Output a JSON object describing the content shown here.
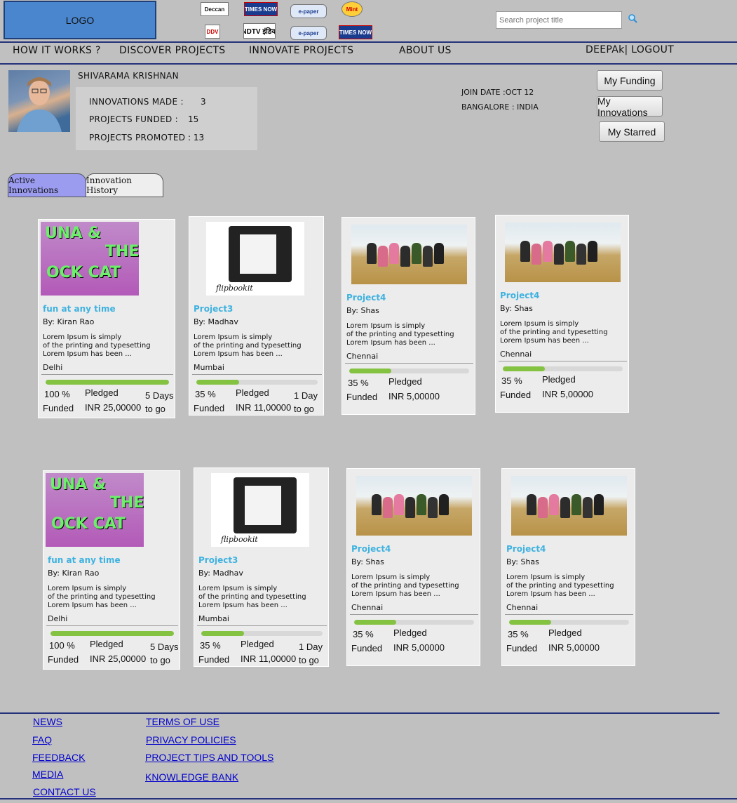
{
  "header": {
    "logo": "LOGO",
    "search": {
      "placeholder": "Search project title",
      "value": "Search project title"
    },
    "media_logos": [
      "Deccan",
      "TIMES NOW",
      "e-paper",
      "Mint",
      "DDV",
      "NDTV इंडिया",
      "e-paper",
      "TIMES NOW"
    ]
  },
  "nav": {
    "how_it_works": "HOW IT WORKS ?",
    "discover": "DISCOVER PROJECTS",
    "innovate": "INNOVATE PROJECTS",
    "about": "ABOUT US",
    "user": "DEEPAk| LOGOUT"
  },
  "profile": {
    "name": "SHIVARAMA KRISHNAN",
    "innovations_label": "INNOVATIONS MADE :",
    "innovations_value": "3",
    "funded_label": "PROJECTS FUNDED :",
    "funded_value": "15",
    "promoted_label": "PROJECTS PROMOTED",
    "promoted_value": ": 13",
    "join_date": "JOIN DATE :OCT 12",
    "location": "BANGALORE : INDIA"
  },
  "buttons": {
    "funding": "My Funding",
    "innovations": "My Innovations",
    "starred": "My Starred"
  },
  "tabs": {
    "active": "Active Innovations",
    "history": "Innovation History"
  },
  "colors": {
    "accent": "#3fb2e0",
    "progress": "#84c242",
    "tab_active": "#9b9bf0",
    "rule": "#26327a"
  },
  "cards": [
    {
      "title": "fun at any time",
      "by": "By:  Kiran Rao",
      "desc1": "Lorem Ipsum is simply",
      "desc2": "of the printing and typesetting",
      "desc3": "Lorem Ipsum has been ...",
      "location": "Delhi",
      "progress": 1.0,
      "funded": "100 %",
      "funded_label": "Funded",
      "pledged_label": "Pledged",
      "pledged": "INR 25,00000",
      "days": "5 Days",
      "days_label": "to go"
    },
    {
      "title": "Project3",
      "by": "By:  Madhav",
      "desc1": "Lorem Ipsum is simply",
      "desc2": "of the printing and typesetting",
      "desc3": "Lorem Ipsum has been ...",
      "location": "Mumbai",
      "progress": 0.35,
      "funded": "35 %",
      "funded_label": "Funded",
      "pledged_label": "Pledged",
      "pledged": "INR 11,00000",
      "days": "1 Day",
      "days_label": "to go"
    },
    {
      "title": "Project4",
      "by": "By:  Shas",
      "desc1": "Lorem Ipsum is simply",
      "desc2": "of the printing and typesetting",
      "desc3": "Lorem Ipsum has been ...",
      "location": "Chennai",
      "progress": 0.35,
      "funded": "35 %",
      "funded_label": "Funded",
      "pledged_label": "Pledged",
      "pledged": "INR 5,00000"
    },
    {
      "title": "Project4",
      "by": "By:  Shas",
      "desc1": "Lorem Ipsum is simply",
      "desc2": "of the printing and typesetting",
      "desc3": "Lorem Ipsum has been ...",
      "location": "Chennai",
      "progress": 0.35,
      "funded": "35 %",
      "funded_label": "Funded",
      "pledged_label": "Pledged",
      "pledged": "INR 5,00000"
    },
    {
      "title": "fun at any time",
      "by": "By:  Kiran Rao",
      "desc1": "Lorem Ipsum is simply",
      "desc2": "of the printing and typesetting",
      "desc3": "Lorem Ipsum has been ...",
      "location": "Delhi",
      "progress": 1.0,
      "funded": "100 %",
      "funded_label": "Funded",
      "pledged_label": "Pledged",
      "pledged": "INR 25,00000",
      "days": "5 Days",
      "days_label": "to go"
    },
    {
      "title": "Project3",
      "by": "By:  Madhav",
      "desc1": "Lorem Ipsum is simply",
      "desc2": "of the printing and typesetting",
      "desc3": "Lorem Ipsum has been ...",
      "location": "Mumbai",
      "progress": 0.35,
      "funded": "35 %",
      "funded_label": "Funded",
      "pledged_label": "Pledged",
      "pledged": "INR 11,00000",
      "days": "1 Day",
      "days_label": "to go"
    },
    {
      "title": "Project4",
      "by": "By:  Shas",
      "desc1": "Lorem Ipsum is simply",
      "desc2": "of the printing and typesetting",
      "desc3": "Lorem Ipsum has been ...",
      "location": "Chennai",
      "progress": 0.35,
      "funded": "35 %",
      "funded_label": "Funded",
      "pledged_label": "Pledged",
      "pledged": "INR 5,00000"
    },
    {
      "title": "Project4",
      "by": "By:  Shas",
      "desc1": "Lorem Ipsum is simply",
      "desc2": "of the printing and typesetting",
      "desc3": "Lorem Ipsum has been ...",
      "location": "Chennai",
      "progress": 0.35,
      "funded": "35 %",
      "funded_label": "Funded",
      "pledged_label": "Pledged",
      "pledged": "INR 5,00000"
    }
  ],
  "footer": {
    "news": "NEWS",
    "faq": "FAQ",
    "feedback": "FEEDBACK",
    "media": "MEDIA",
    "contact": "CONTACT US",
    "terms": "TERMS OF USE",
    "privacy": "PRIVACY POLICIES",
    "tips": "PROJECT TIPS AND TOOLS",
    "knowledge": "KNOWLEDGE BANK"
  }
}
